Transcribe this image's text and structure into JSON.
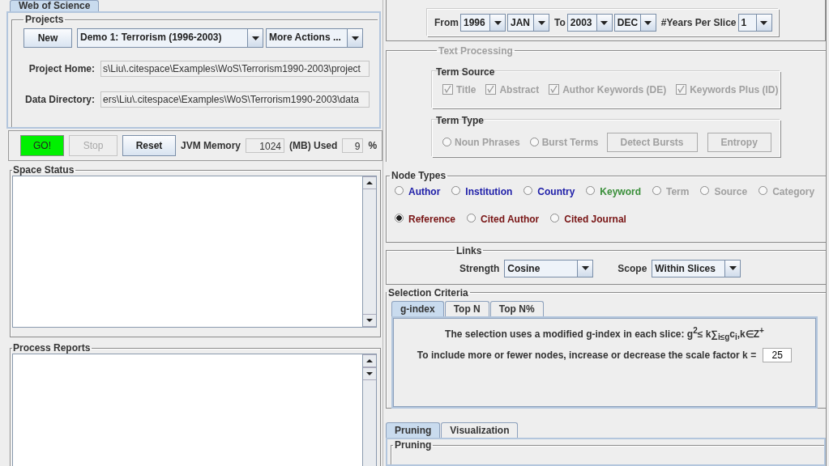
{
  "source_tabs": [
    {
      "label": "Web of Science",
      "selected": true
    }
  ],
  "projects": {
    "title": "Projects",
    "new_button": "New",
    "project_select": "Demo 1: Terrorism (1996-2003)",
    "actions_select": "More Actions ...",
    "fields": [
      {
        "label": "Project Home:",
        "value": "s\\Liu\\.citespace\\Examples\\WoS\\Terrorism1990-2003\\project"
      },
      {
        "label": "Data Directory:",
        "value": "ers\\Liu\\.citespace\\Examples\\WoS\\Terrorism1990-2003\\data"
      }
    ]
  },
  "run_bar": {
    "buttons": [
      {
        "label": "GO!",
        "kind": "go",
        "disabled": false
      },
      {
        "label": "Stop",
        "kind": "plain",
        "disabled": true
      },
      {
        "label": "Reset",
        "kind": "plain",
        "disabled": false
      }
    ],
    "memory_label": "JVM Memory",
    "memory_value": "1024",
    "used_label": "(MB) Used",
    "used_value": "9",
    "percent": "%"
  },
  "space_status": {
    "title": "Space Status"
  },
  "process_reports": {
    "title": "Process Reports"
  },
  "time_slicing": {
    "from_label": "From",
    "from_year": "1996",
    "from_month": "JAN",
    "to_label": "To",
    "to_year": "2003",
    "to_month": "DEC",
    "slice_label": "#Years Per Slice",
    "slice_value": "1"
  },
  "text_processing": {
    "title": "Text Processing",
    "disabled": true,
    "term_source": {
      "title": "Term Source",
      "options": [
        {
          "label": "Title",
          "checked": true
        },
        {
          "label": "Abstract",
          "checked": true
        },
        {
          "label": "Author Keywords (DE)",
          "checked": true
        },
        {
          "label": "Keywords Plus (ID)",
          "checked": true
        }
      ]
    },
    "term_type": {
      "title": "Term Type",
      "options": [
        {
          "label": "Noun Phrases",
          "selected": false
        },
        {
          "label": "Burst Terms",
          "selected": false
        }
      ],
      "buttons": [
        "Detect Bursts",
        "Entropy"
      ]
    }
  },
  "node_types": {
    "title": "Node Types",
    "rows": [
      {
        "items": [
          {
            "label": "Author",
            "selected": false,
            "color": "#1c1ca8"
          },
          {
            "label": "Institution",
            "selected": false,
            "color": "#1c1ca8"
          },
          {
            "label": "Country",
            "selected": false,
            "color": "#1c1ca8"
          },
          {
            "label": "Keyword",
            "selected": false,
            "color": "#3a8f3a"
          },
          {
            "label": "Term",
            "selected": false,
            "color": "#a0a0a0"
          },
          {
            "label": "Source",
            "selected": false,
            "color": "#a0a0a0"
          },
          {
            "label": "Category",
            "selected": false,
            "color": "#a0a0a0"
          }
        ]
      },
      {
        "items": [
          {
            "label": "Reference",
            "selected": true,
            "color": "#781414"
          },
          {
            "label": "Cited Author",
            "selected": false,
            "color": "#781414"
          },
          {
            "label": "Cited Journal",
            "selected": false,
            "color": "#781414"
          }
        ]
      }
    ]
  },
  "links": {
    "title": "Links",
    "strength_label": "Strength",
    "strength_value": "Cosine",
    "scope_label": "Scope",
    "scope_value": "Within Slices"
  },
  "selection_criteria": {
    "title": "Selection Criteria",
    "tabs": [
      {
        "label": "g-index",
        "selected": true
      },
      {
        "label": "Top N",
        "selected": false
      },
      {
        "label": "Top N%",
        "selected": false
      }
    ],
    "formula": "The selection uses a modified g-index in each slice: g$^{2}$≤ k∑$_{i≤g}$c$_{i}$,k∈Z$^{+}$",
    "k_label": "To include more or fewer nodes, increase or decrease the scale factor k =",
    "k_value": "25"
  },
  "bottom_tabs": [
    {
      "label": "Pruning",
      "selected": true
    },
    {
      "label": "Visualization",
      "selected": false
    }
  ],
  "pruning": {
    "title": "Pruning"
  }
}
